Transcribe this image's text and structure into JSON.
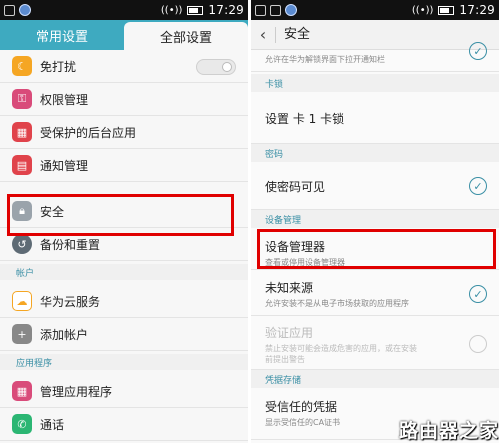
{
  "status": {
    "time": "17:29"
  },
  "left": {
    "tabs": [
      "常用设置",
      "全部设置"
    ],
    "items": [
      {
        "label": "免打扰",
        "icon": "moon-icon",
        "color": "#f5a623"
      },
      {
        "label": "权限管理",
        "icon": "permission-icon",
        "color": "#d94b7a"
      },
      {
        "label": "受保护的后台应用",
        "icon": "apps-icon",
        "color": "#e0434b"
      },
      {
        "label": "通知管理",
        "icon": "notification-icon",
        "color": "#e0434b"
      },
      {
        "label": "安全",
        "icon": "lock-icon",
        "color": "#9aa3ab"
      },
      {
        "label": "备份和重置",
        "icon": "backup-icon",
        "color": "#5e6b75"
      }
    ],
    "section_account": "帐户",
    "account_items": [
      {
        "label": "华为云服务",
        "icon": "cloud-icon",
        "color": "#f5a623"
      },
      {
        "label": "添加帐户",
        "icon": "plus-icon",
        "color": "#888888"
      }
    ],
    "section_apps": "应用程序",
    "app_items": [
      {
        "label": "管理应用程序",
        "icon": "grid-icon",
        "color": "#d94b7a"
      },
      {
        "label": "通话",
        "icon": "phone-icon",
        "color": "#2bb673"
      }
    ]
  },
  "right": {
    "title": "安全",
    "top_sub": "允许在华为解锁界面下拉开通知栏",
    "section_sim": "卡锁",
    "sim_lock": "设置 卡 1 卡锁",
    "section_password": "密码",
    "show_password": "使密码可见",
    "section_device_admin": "设备管理",
    "device_admin": {
      "title": "设备管理器",
      "sub": "查看或停用设备管理器"
    },
    "unknown_sources": {
      "title": "未知来源",
      "sub": "允许安装不是从电子市场获取的应用程序"
    },
    "verify_apps": {
      "title": "验证应用",
      "sub1": "禁止安装可能会造成危害的应用，或在安装",
      "sub2": "前提出警告"
    },
    "section_credentials": "凭据存储",
    "trusted_credentials": {
      "title": "受信任的凭据",
      "sub": "显示受信任的CA证书"
    }
  },
  "watermark": "路由器之家"
}
